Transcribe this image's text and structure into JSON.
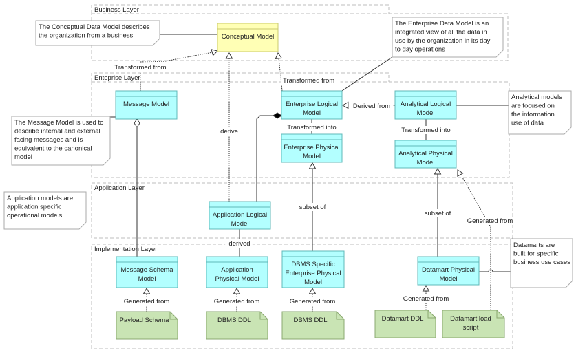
{
  "layers": {
    "business": "Business Layer",
    "enterprise": "Enteprise Layer",
    "application": "Application Layer",
    "implementation": "Implementation Layer"
  },
  "nodes": {
    "conceptual": [
      "Conceptual Model"
    ],
    "message": [
      "Message Model"
    ],
    "ent_logical": [
      "Enterprise Logical",
      "Model"
    ],
    "ent_physical": [
      "Enterprise Physical",
      "Model"
    ],
    "ana_logical": [
      "Analytical Logical",
      "Model"
    ],
    "ana_physical": [
      "Analytical Physical",
      "Model"
    ],
    "app_logical": [
      "Application Logical",
      "Model"
    ],
    "msg_schema": [
      "Message Schema",
      "Model"
    ],
    "app_physical": [
      "Application",
      "Physical Model"
    ],
    "dbms_specific": [
      "DBMS Specific",
      "Enterprise Physical",
      "Model"
    ],
    "datamart_physical": [
      "Datamart Physical",
      "Model"
    ]
  },
  "artifacts": {
    "payload": [
      "Payload Schema"
    ],
    "ddl1": [
      "DBMS DDL"
    ],
    "ddl2": [
      "DBMS DDL"
    ],
    "datamart_ddl": [
      "Datamart DDL"
    ],
    "datamart_load": [
      "Datamart load",
      "script"
    ]
  },
  "notes": {
    "conceptual": [
      "The  Conceptual  Data Model describes",
      "the organization from a business"
    ],
    "enterprise": [
      "The Enterprise Data Model is an",
      "integrated view of all the data in",
      "use by the organization in its day",
      "to day operations"
    ],
    "message": [
      "The Message Model is used to",
      "describe internal and external",
      "facing messages and is",
      "equivalent to the canonical",
      "model"
    ],
    "analytical": [
      "Analytical models",
      "are focused on",
      "the information",
      "use of data"
    ],
    "application": [
      "Application models are",
      "application specific",
      "operational models"
    ],
    "datamart": [
      "Datamarts are",
      "built for specific",
      "business use cases"
    ]
  },
  "relations": {
    "msg_transformed": "Transformed from",
    "derive": "derive",
    "ent_transformed": "Transformed from",
    "derived_from": "Derived from",
    "ent_into": "Transformed into",
    "ana_into": "Transformed into",
    "subset1": "subset of",
    "subset2": "subset of",
    "generated_dm": "Generated from",
    "derived": "derived",
    "gen1": "Generated from",
    "gen2": "Generated from",
    "gen3": "Generated from",
    "gen4": "Generated from"
  },
  "colors": {
    "model": "#b3ffff",
    "conceptual": "#ffffb5",
    "artifact": "#c9e4b4"
  }
}
